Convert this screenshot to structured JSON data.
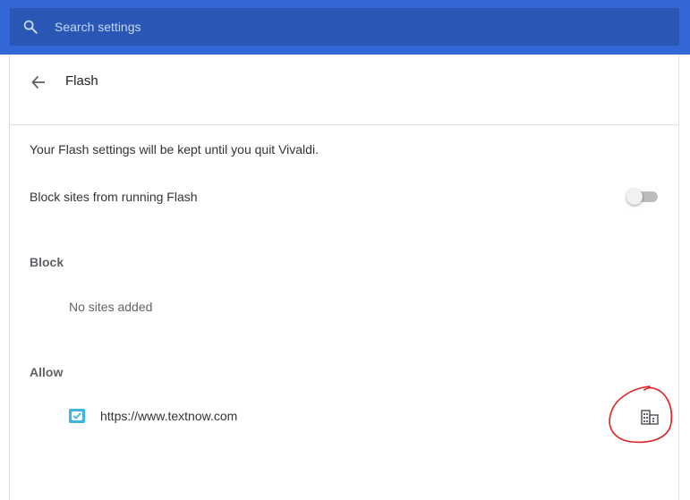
{
  "search": {
    "placeholder": "Search settings"
  },
  "header": {
    "title": "Flash"
  },
  "content": {
    "info_text": "Your Flash settings will be kept until you quit Vivaldi.",
    "block_flash_label": "Block sites from running Flash",
    "block_flash_enabled": false,
    "block_section": {
      "heading": "Block",
      "empty_text": "No sites added"
    },
    "allow_section": {
      "heading": "Allow",
      "sites": [
        {
          "url": "https://www.textnow.com",
          "icon": "textnow-favicon",
          "policy_icon": "enterprise-policy-icon"
        }
      ]
    }
  },
  "colors": {
    "topbar": "#3367d6",
    "searchbox": "#2a56b5",
    "annotation": "#e02020"
  }
}
